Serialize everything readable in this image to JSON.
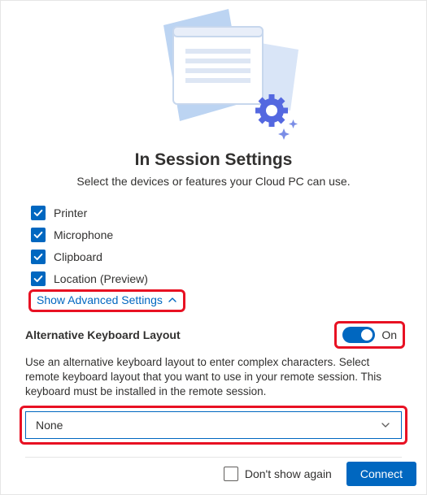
{
  "title": "In Session Settings",
  "subtitle": "Select the devices or features your Cloud PC can use.",
  "checks": [
    {
      "label": "Printer",
      "checked": true
    },
    {
      "label": "Microphone",
      "checked": true
    },
    {
      "label": "Clipboard",
      "checked": true
    },
    {
      "label": "Location (Preview)",
      "checked": true
    }
  ],
  "advanced_link": "Show Advanced Settings",
  "alt_kb": {
    "title": "Alternative Keyboard Layout",
    "toggle_state": "On",
    "description": "Use an alternative keyboard layout to enter complex characters. Select remote keyboard layout that you want to use in your remote session. This keyboard must be installed in the remote session.",
    "selected": "None"
  },
  "footer": {
    "dont_show": "Don't show again",
    "connect": "Connect"
  }
}
